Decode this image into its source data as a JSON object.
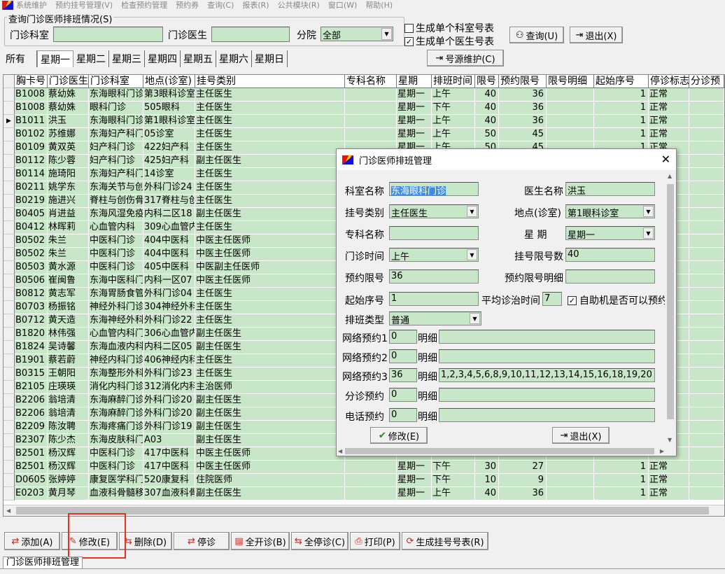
{
  "menu": [
    "系统维护",
    "预约挂号管理(V)",
    "检查预约管理",
    "预约券",
    "查询(C)",
    "报表(R)",
    "公共模块(R)",
    "窗口(W)",
    "帮助(H)"
  ],
  "query": {
    "legend": "查询门诊医师排班情况(S)",
    "dept_label": "门诊科室",
    "dept_value": "",
    "doctor_label": "门诊医生",
    "doctor_value": "",
    "branch_label": "分院",
    "branch_value": "全部",
    "chk_dept_label": "生成单个科室号表",
    "chk_dept_checked": false,
    "chk_doctor_label": "生成单个医生号表",
    "chk_doctor_checked": true,
    "search_label": "查询(U)",
    "exit_label": "退出(X)"
  },
  "tabs": [
    "所有",
    "星期一",
    "星期二",
    "星期三",
    "星期四",
    "星期五",
    "星期六",
    "星期日"
  ],
  "active_tab": 1,
  "source_button": "号源维护(C)",
  "grid": {
    "headers": [
      "胸卡号",
      "门诊医生",
      "门诊科室",
      "地点(诊室)",
      "挂号类别",
      "专科名称",
      "星期",
      "排班时间",
      "限号",
      "预约限号",
      "限号明细",
      "起始序号",
      "停诊标志",
      "分诊预"
    ],
    "rows": [
      [
        "B1008",
        "蔡幼姝",
        "东海眼科门诊",
        "第3眼科诊室",
        "主任医生",
        "",
        "星期一",
        "上午",
        "40",
        "36",
        "",
        "1",
        "正常",
        ""
      ],
      [
        "B1008",
        "蔡幼姝",
        "眼科门诊",
        "505眼科",
        "主任医生",
        "",
        "星期一",
        "下午",
        "40",
        "36",
        "",
        "1",
        "正常",
        ""
      ],
      [
        "B1011",
        "洪玉",
        "东海眼科门诊",
        "第1眼科诊室",
        "主任医生",
        "",
        "星期一",
        "上午",
        "40",
        "36",
        "",
        "1",
        "正常",
        ""
      ],
      [
        "B0102",
        "苏维娜",
        "东海妇产科门诊",
        "05诊室",
        "主任医生",
        "",
        "星期一",
        "上午",
        "50",
        "45",
        "",
        "1",
        "正常",
        ""
      ],
      [
        "B0109",
        "黄双英",
        "妇产科门诊",
        "422妇产科",
        "主任医生",
        "",
        "星期一",
        "上午",
        "50",
        "45",
        "",
        "1",
        "正常",
        ""
      ],
      [
        "B0112",
        "陈少蓉",
        "妇产科门诊",
        "425妇产科",
        "副主任医生",
        "",
        "",
        "",
        "",
        "",
        "",
        "",
        "",
        ""
      ],
      [
        "B0114",
        "施琦阳",
        "东海妇产科门诊",
        "14诊室",
        "主任医生",
        "",
        "",
        "",
        "",
        "",
        "",
        "",
        "",
        ""
      ],
      [
        "B0211",
        "姚学东",
        "东海关节与创伤",
        "外科门诊24",
        "主任医生",
        "",
        "",
        "",
        "",
        "",
        "",
        "",
        "",
        ""
      ],
      [
        "B0219",
        "施进兴",
        "脊柱与创伤骨科",
        "317脊柱与创",
        "主任医生",
        "",
        "",
        "",
        "",
        "",
        "",
        "",
        "",
        ""
      ],
      [
        "B0405",
        "肖进益",
        "东海风湿免疫科",
        "内科二区18",
        "副主任医生",
        "",
        "",
        "",
        "",
        "",
        "",
        "",
        "",
        ""
      ],
      [
        "B0412",
        "林晖莉",
        "心血管内科",
        "309心血管内",
        "主任医生",
        "",
        "",
        "",
        "",
        "",
        "",
        "",
        "",
        ""
      ],
      [
        "B0502",
        "朱兰",
        "中医科门诊",
        "404中医科",
        "中医主任医师",
        "",
        "",
        "",
        "",
        "",
        "",
        "",
        "",
        ""
      ],
      [
        "B0502",
        "朱兰",
        "中医科门诊",
        "404中医科",
        "中医主任医师",
        "",
        "",
        "",
        "",
        "",
        "",
        "",
        "",
        ""
      ],
      [
        "B0503",
        "黄水源",
        "中医科门诊",
        "405中医科",
        "中医副主任医师",
        "",
        "",
        "",
        "",
        "",
        "",
        "",
        "",
        ""
      ],
      [
        "B0506",
        "崔闽鲁",
        "东海中医科门诊",
        "内科一区07",
        "中医主任医师",
        "",
        "",
        "",
        "",
        "",
        "",
        "",
        "",
        ""
      ],
      [
        "B0812",
        "黄志军",
        "东海胃肠食管",
        "外科门诊04",
        "主任医生",
        "",
        "",
        "",
        "",
        "",
        "",
        "",
        "",
        ""
      ],
      [
        "B0703",
        "杨振铭",
        "神经外科门诊",
        "304神经外科",
        "主任医生",
        "",
        "",
        "",
        "",
        "",
        "",
        "",
        "",
        ""
      ],
      [
        "B0712",
        "黄天造",
        "东海神经外科",
        "外科门诊22",
        "主任医生",
        "",
        "",
        "",
        "",
        "",
        "",
        "",
        "",
        ""
      ],
      [
        "B1820",
        "林伟强",
        "心血管内科门诊",
        "306心血管内",
        "副主任医生",
        "",
        "",
        "",
        "",
        "",
        "",
        "",
        "",
        ""
      ],
      [
        "B1824",
        "吴诗馨",
        "东海血液内科",
        "内科二区05",
        "副主任医生",
        "",
        "",
        "",
        "",
        "",
        "",
        "",
        "",
        ""
      ],
      [
        "B1901",
        "蔡若蔚",
        "神经内科门诊",
        "406神经内科",
        "主任医生",
        "",
        "",
        "",
        "",
        "",
        "",
        "",
        "",
        ""
      ],
      [
        "B0315",
        "王朝阳",
        "东海整形外科",
        "外科门诊23",
        "主任医生",
        "",
        "",
        "",
        "",
        "",
        "",
        "",
        "",
        ""
      ],
      [
        "B2105",
        "庄瑛瑛",
        "消化内科门诊",
        "312消化内科",
        "主治医师",
        "",
        "",
        "",
        "",
        "",
        "",
        "",
        "",
        ""
      ],
      [
        "B2206",
        "翁培清",
        "东海麻醉门诊",
        "外科门诊20",
        "副主任医生",
        "",
        "",
        "",
        "",
        "",
        "",
        "",
        "",
        ""
      ],
      [
        "B2206",
        "翁培清",
        "东海麻醉门诊",
        "外科门诊20",
        "副主任医生",
        "",
        "",
        "",
        "",
        "",
        "",
        "",
        "",
        ""
      ],
      [
        "B2209",
        "陈汝聘",
        "东海疼痛门诊",
        "外科门诊19",
        "副主任医生",
        "",
        "",
        "",
        "",
        "",
        "",
        "",
        "",
        ""
      ],
      [
        "B2307",
        "陈少杰",
        "东海皮肤科门诊",
        "A03",
        "副主任医生",
        "",
        "",
        "",
        "",
        "",
        "",
        "",
        "",
        ""
      ],
      [
        "B2501",
        "杨汉辉",
        "中医科门诊",
        "417中医科",
        "中医主任医师",
        "",
        "",
        "",
        "",
        "",
        "",
        "",
        "",
        ""
      ],
      [
        "B2501",
        "杨汉辉",
        "中医科门诊",
        "417中医科",
        "中医主任医师",
        "",
        "星期一",
        "下午",
        "30",
        "27",
        "",
        "1",
        "正常",
        ""
      ],
      [
        "D0605",
        "张婷婷",
        "康复医学科门诊",
        "520康复科",
        "住院医师",
        "",
        "星期一",
        "下午",
        "10",
        "9",
        "",
        "1",
        "正常",
        ""
      ],
      [
        "E0203",
        "黄月琴",
        "血液科骨髓移植",
        "307血液科骨",
        "副主任医生",
        "",
        "星期一",
        "上午",
        "40",
        "36",
        "",
        "1",
        "正常",
        ""
      ]
    ],
    "current_row": 2
  },
  "bottom_buttons": [
    {
      "label": "添加(A)",
      "icon": "⇄"
    },
    {
      "label": "修改(E)",
      "icon": "✎"
    },
    {
      "label": "删除(D)",
      "icon": "⇆"
    },
    {
      "label": "停诊",
      "icon": "⇄"
    },
    {
      "label": "全开诊(B)",
      "icon": "▤"
    },
    {
      "label": "全停诊(C)",
      "icon": "⇆"
    },
    {
      "label": "打印(P)",
      "icon": "⎙"
    },
    {
      "label": "生成挂号号表(R)",
      "icon": "⟳"
    }
  ],
  "status_tab": "门诊医师排班管理",
  "dialog": {
    "title": "门诊医师排班管理",
    "dept_label": "科室名称",
    "dept_value": "东海眼科门诊",
    "doctor_label": "医生名称",
    "doctor_value": "洪玉",
    "type_label": "挂号类别",
    "type_value": "主任医生",
    "room_label": "地点(诊室)",
    "room_value": "第1眼科诊室",
    "spec_label": "专科名称",
    "spec_value": "",
    "week_label": "星 期",
    "week_value": "星期一",
    "time_label": "门诊时间",
    "time_value": "上午",
    "limit_label": "挂号限号数",
    "limit_value": "40",
    "appt_label": "预约限号",
    "appt_value": "36",
    "appt_detail_label": "预约限号明细",
    "appt_detail_value": "",
    "start_label": "起始序号",
    "start_value": "1",
    "avg_label": "平均诊治时间",
    "avg_value": "7",
    "kiosk_label": "自助机是否可以预约",
    "kiosk_checked": true,
    "sched_label": "排班类型",
    "sched_value": "普通",
    "net1_label": "网络预约1",
    "net1_value": "0",
    "net2_label": "网络预约2",
    "net2_value": "0",
    "net3_label": "网络预约3",
    "net3_value": "36",
    "triage_label": "分诊预约",
    "triage_value": "0",
    "phone_label": "电话预约",
    "phone_value": "0",
    "detail_label": "明细",
    "net1_detail": "",
    "net2_detail": "",
    "net3_detail": "1,2,3,4,5,6,8,9,10,11,12,13,14,15,16,18,19,20",
    "triage_detail": "",
    "phone_detail": "",
    "modify_label": "修改(E)",
    "exit_label": "退出(X)"
  }
}
